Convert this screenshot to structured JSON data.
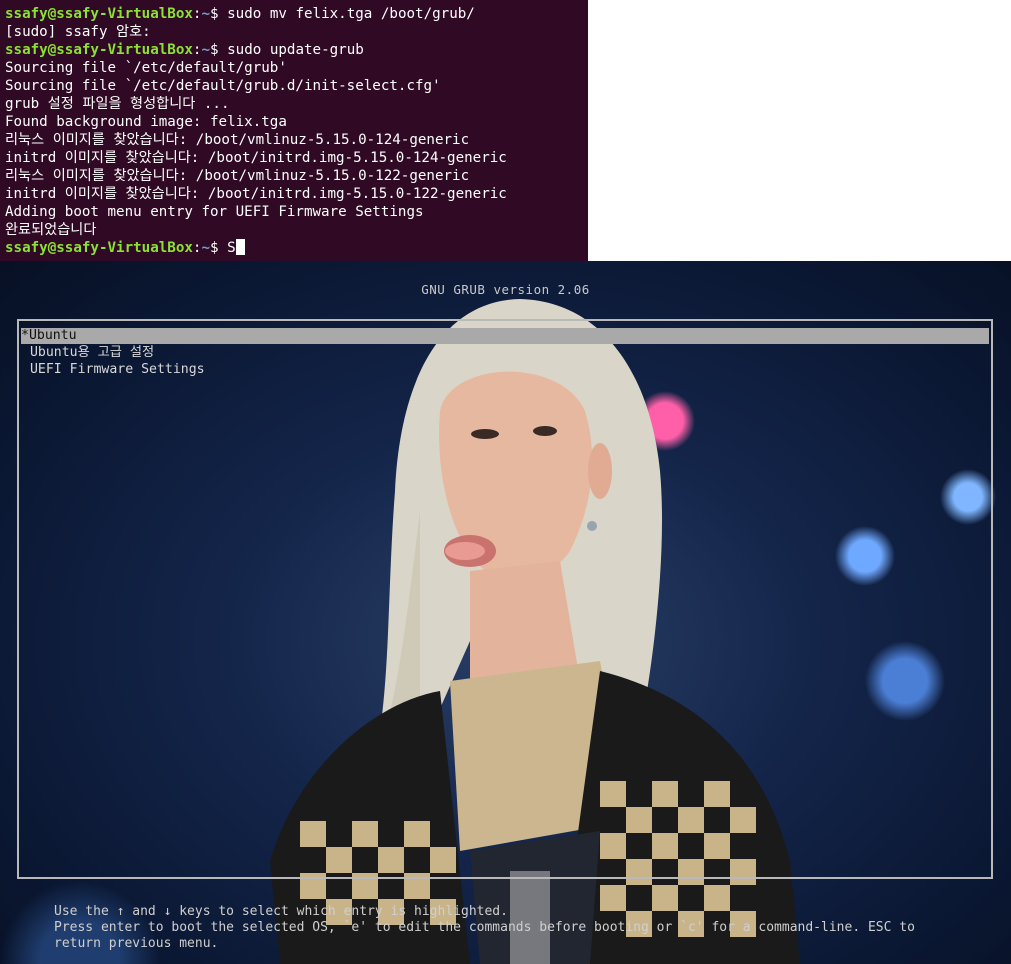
{
  "terminal": {
    "prompt_user": "ssafy@ssafy-VirtualBox",
    "prompt_sep": ":",
    "prompt_path": "~",
    "prompt_symbol": "$ ",
    "lines": {
      "l1_cmd": "sudo mv felix.tga /boot/grub/",
      "l2": "[sudo] ssafy 암호:",
      "l3_cmd": "sudo update-grub",
      "l4": "Sourcing file `/etc/default/grub'",
      "l5": "Sourcing file `/etc/default/grub.d/init-select.cfg'",
      "l6": "grub 설정 파일을 형성합니다 ...",
      "l7": "Found background image: felix.tga",
      "l8": "리눅스 이미지를 찾았습니다: /boot/vmlinuz-5.15.0-124-generic",
      "l9": "initrd 이미지를 찾았습니다: /boot/initrd.img-5.15.0-124-generic",
      "l10": "리눅스 이미지를 찾았습니다: /boot/vmlinuz-5.15.0-122-generic",
      "l11": "initrd 이미지를 찾았습니다: /boot/initrd.img-5.15.0-122-generic",
      "l12": "Adding boot menu entry for UEFI Firmware Settings",
      "l13": "완료되었습니다",
      "l14_cmd": "S"
    }
  },
  "grub": {
    "title": "GNU GRUB  version 2.06",
    "menu": [
      {
        "label": "*Ubuntu"
      },
      {
        "label": " Ubuntu용 고급 설정"
      },
      {
        "label": " UEFI Firmware Settings"
      }
    ],
    "help": "Use the ↑ and ↓ keys to select which entry is highlighted.\nPress enter to boot the selected OS, `e' to edit the commands before booting or `c' for a command-line. ESC to\nreturn previous menu."
  },
  "colors": {
    "terminal_bg": "#300a24",
    "prompt_user": "#8ae234",
    "prompt_path": "#729fcf",
    "grub_highlight": "#a9a9a9"
  }
}
